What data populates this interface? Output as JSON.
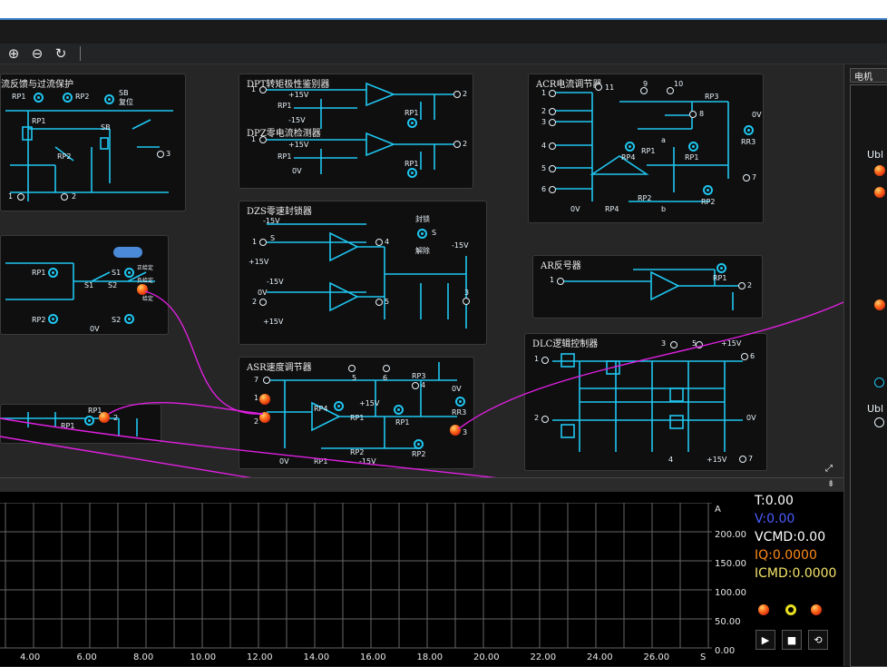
{
  "toolbar": {
    "zoom_in": "⊕",
    "zoom_out": "⊖",
    "refresh": "↻"
  },
  "modules": {
    "overcurrent": {
      "title": "流反馈与过流保护",
      "labels": [
        "RP1",
        "RP2",
        "SB",
        "复位",
        "RP1",
        "SB",
        "RP2",
        "3",
        "1",
        "2"
      ]
    },
    "dpt": {
      "title": "DPT转矩极性鉴别器",
      "labels": [
        "1",
        "+15V",
        "RP1",
        "-15V",
        "RP1",
        "2",
        "RP1"
      ]
    },
    "dpz": {
      "title": "DPZ零电流检测器",
      "labels": [
        "1",
        "+15V",
        "RP1",
        "0V",
        "RP1",
        "2"
      ]
    },
    "acr": {
      "title": "ACR电流调节器",
      "labels": [
        "1",
        "11",
        "9",
        "10",
        "2",
        "3",
        "RP3",
        "8",
        "0V",
        "RR3",
        "4",
        "RP4",
        "RP1",
        "a",
        "RP1",
        "5",
        "7",
        "6",
        "0V",
        "RP4",
        "RP2",
        "b",
        "RP2"
      ]
    },
    "dzs": {
      "title": "DZS零速封锁器",
      "labels": [
        "-15V",
        "封锁",
        "S",
        "1",
        "S",
        "4",
        "解除",
        "-15V",
        "+15V",
        "-15V",
        "3",
        "0V",
        "2",
        "5",
        "+15V"
      ]
    },
    "speed_ref": {
      "labels": [
        "RP1",
        "S1",
        "S1",
        "S2",
        "RP2",
        "S2",
        "0V",
        "正给定",
        "负给定",
        "给定"
      ]
    },
    "ar": {
      "title": "AR反号器",
      "labels": [
        "1",
        "RP1",
        "2"
      ]
    },
    "dlc": {
      "title": "DLC逻辑控制器",
      "labels": [
        "1",
        "3",
        "5",
        "+15V",
        "6",
        "2",
        "0V",
        "4",
        "+15V",
        "7"
      ]
    },
    "asr": {
      "title": "ASR速度调节器",
      "labels": [
        "7",
        "5",
        "6",
        "4",
        "RP3",
        "0V",
        "1",
        "RP4",
        "+15V",
        "RR3",
        "2",
        "RP1",
        "RP1",
        "3",
        "RP2",
        "RP2",
        "0V",
        "RP1",
        "-15V"
      ]
    },
    "filter": {
      "labels": [
        "RP1",
        "RP1",
        "2"
      ]
    }
  },
  "side_panel": {
    "tab": "电机",
    "label_top": "Ubl",
    "label_bottom": "Ubl"
  },
  "scope": {
    "readouts": [
      {
        "text": "T:0.00",
        "color": "#ffffff"
      },
      {
        "text": "V:0.00",
        "color": "#4a5cff"
      },
      {
        "text": "VCMD:0.00",
        "color": "#ffffff"
      },
      {
        "text": "IQ:0.0000",
        "color": "#ff8a1a"
      },
      {
        "text": "ICMD:0.0000",
        "color": "#f2e36a"
      }
    ],
    "y_unit": "A",
    "y_ticks": [
      "200.00",
      "150.00",
      "100.00",
      "50.00",
      "0.00"
    ],
    "x_ticks": [
      "4.00",
      "6.00",
      "8.00",
      "10.00",
      "12.00",
      "14.00",
      "16.00",
      "18.00",
      "20.00",
      "22.00",
      "24.00",
      "26.00"
    ],
    "x_unit": "S",
    "play": "▶",
    "stop": "■",
    "loop": "⟲"
  },
  "colors": {
    "wire": "#1fc6f0",
    "patch_cable": "#e020e0",
    "plug": "#ff4a1a"
  }
}
